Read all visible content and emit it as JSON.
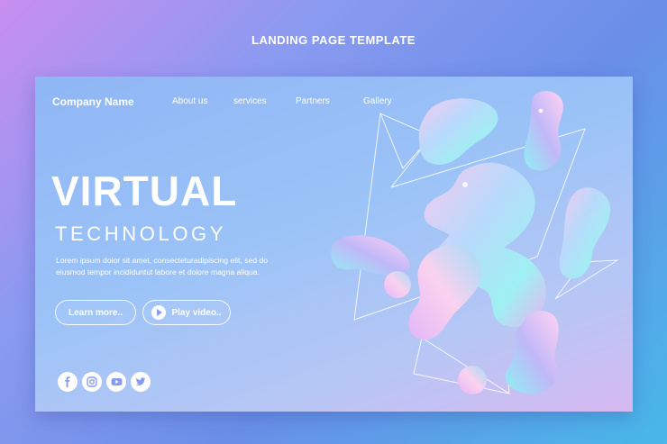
{
  "page": {
    "title": "LANDING PAGE TEMPLATE"
  },
  "nav": {
    "brand": "Company Name",
    "links": [
      "About us",
      "services",
      "Partners",
      "Gallery"
    ]
  },
  "hero": {
    "title": "VIRTUAL",
    "subtitle": "TECHNOLOGY",
    "body": "Lorem ipsum dolor sit amet, consecteturadipiscing elit, sed do eiusmod tempor incididuntut labore et dolore magna aliqua."
  },
  "buttons": {
    "learn_more": "Learn more..",
    "play_video": "Play video.."
  },
  "socials": [
    "facebook-icon",
    "instagram-icon",
    "youtube-icon",
    "twitter-icon"
  ],
  "colors": {
    "accent": "#8a9cf0",
    "text": "#ffffff"
  }
}
